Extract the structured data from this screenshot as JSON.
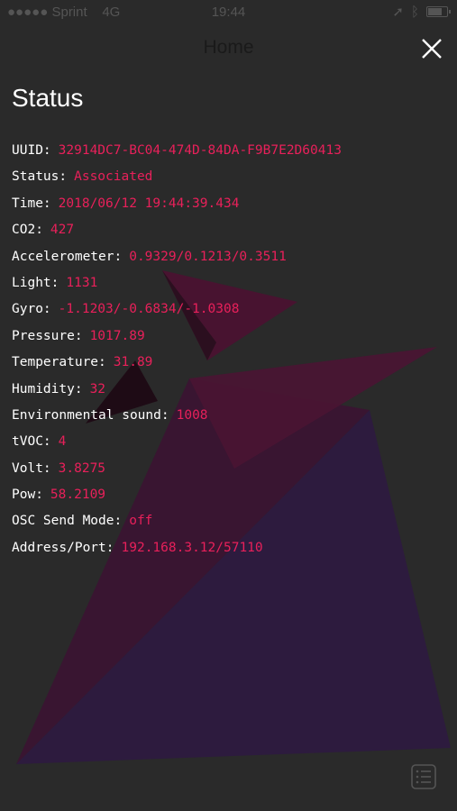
{
  "status_bar": {
    "signal": "●●●●● Sprint",
    "network": "4G",
    "time": "19:44"
  },
  "nav": {
    "title": "Home",
    "close_icon": "close-icon"
  },
  "page": {
    "title": "Status"
  },
  "status_rows": [
    {
      "label": "UUID:",
      "value": "32914DC7-BC04-474D-84DA-F9B7E2D60413"
    },
    {
      "label": "Status:",
      "value": "Associated"
    },
    {
      "label": "Time:",
      "value": "2018/06/12 19:44:39.434"
    },
    {
      "label": "CO2:",
      "value": "427"
    },
    {
      "label": "Accelerometer:",
      "value": "0.9329/0.1213/0.3511"
    },
    {
      "label": "Light:",
      "value": "1131"
    },
    {
      "label": "Gyro:",
      "value": "-1.1203/-0.6834/-1.0308"
    },
    {
      "label": "Pressure:",
      "value": "1017.89"
    },
    {
      "label": "Temperature:",
      "value": "31.89"
    },
    {
      "label": "Humidity:",
      "value": "32"
    },
    {
      "label": "Environmental sound:",
      "value": "1008"
    },
    {
      "label": "tVOC:",
      "value": "4"
    },
    {
      "label": "Volt:",
      "value": "3.8275"
    },
    {
      "label": "Pow:",
      "value": "58.2109"
    },
    {
      "label": "OSC Send Mode:",
      "value": "off"
    },
    {
      "label": "Address/Port:",
      "value": "192.168.3.12/57110"
    }
  ],
  "colors": {
    "background": "#2a2a2a",
    "label": "#ffffff",
    "value": "#e8205a",
    "shape_dark": "#3b1530",
    "shape_purple": "#35174a"
  },
  "footer": {
    "list_icon": "list-icon"
  }
}
